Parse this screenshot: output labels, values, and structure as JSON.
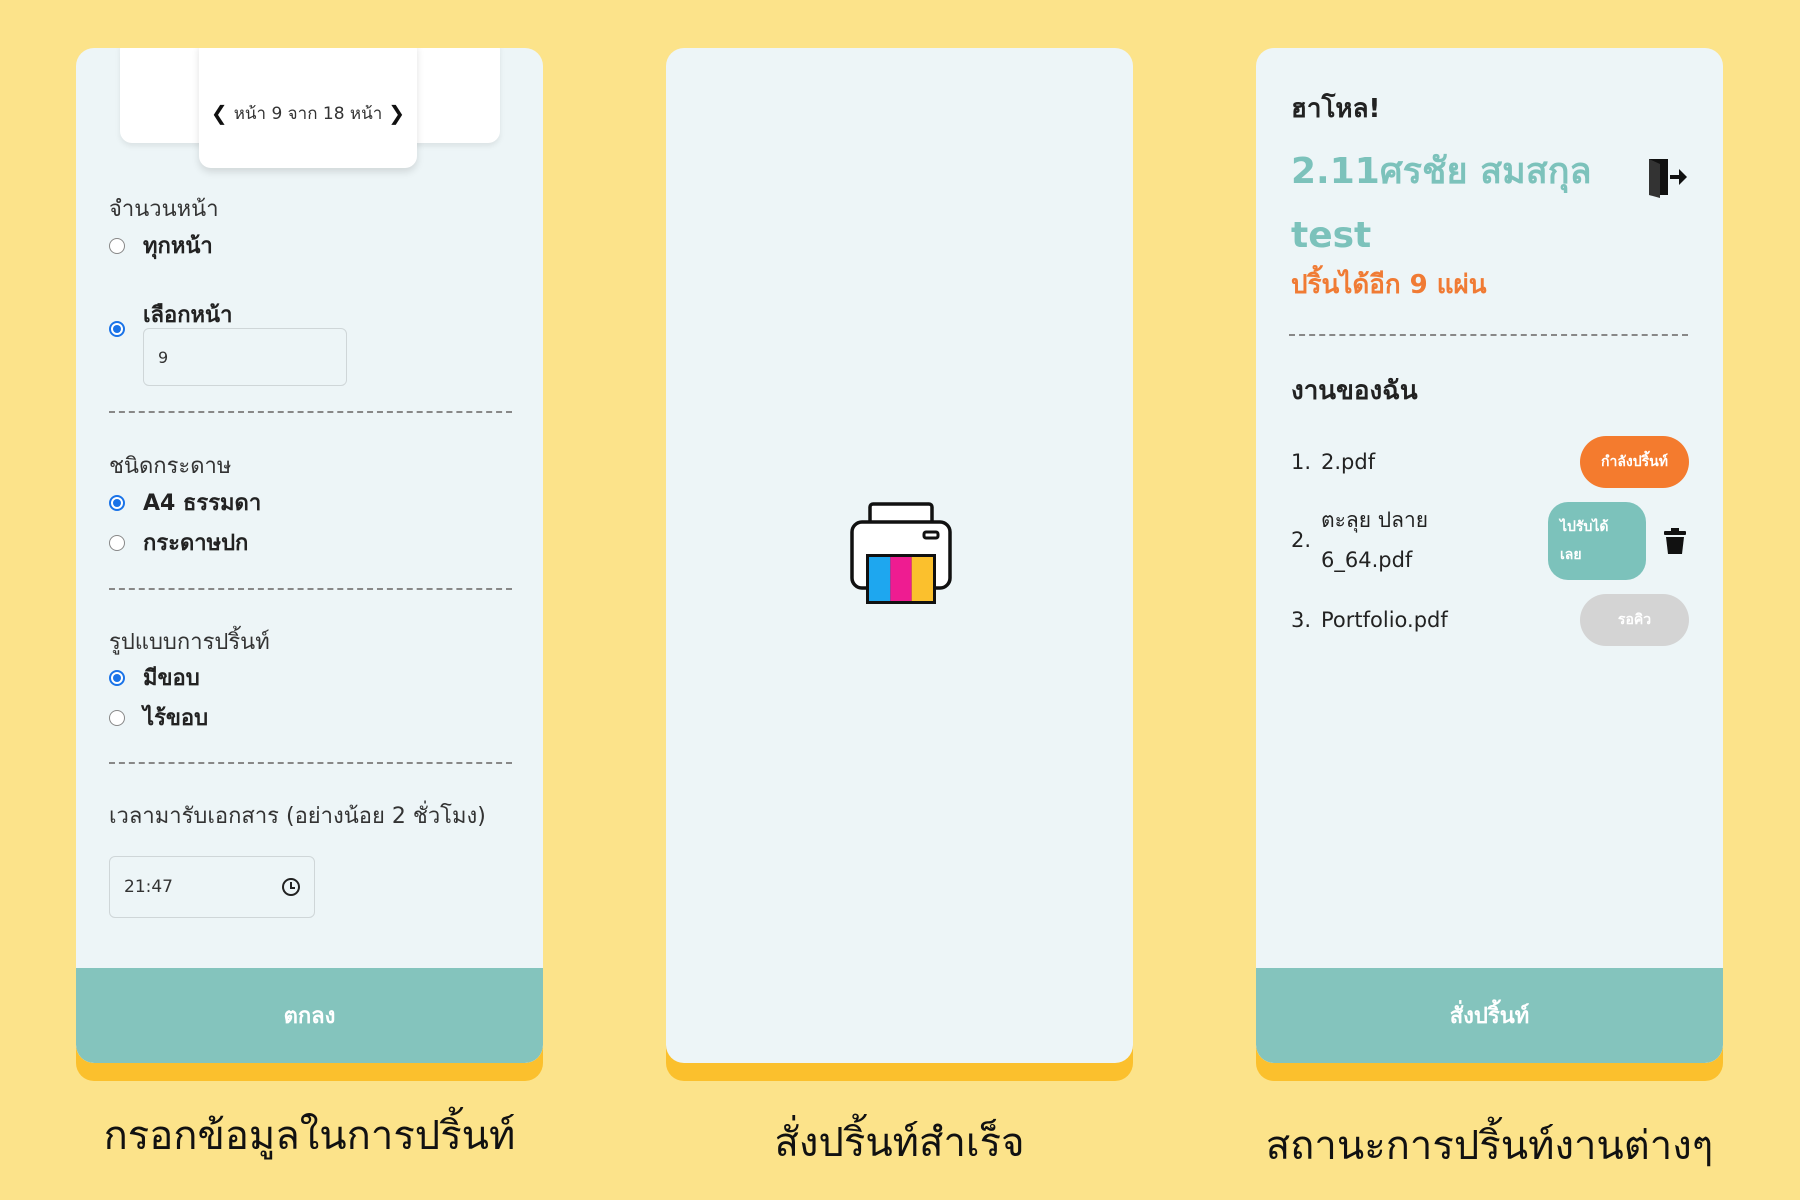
{
  "panel1": {
    "pager": {
      "text": "หน้า 9 จาก 18 หน้า",
      "prev_icon": "chevron-left-icon",
      "next_icon": "chevron-right-icon"
    },
    "pages_section": {
      "title": "จำนวนหน้า",
      "options": [
        "ทุกหน้า",
        "เลือกหน้า"
      ],
      "selected": "เลือกหน้า",
      "page_value": "9"
    },
    "paper_section": {
      "title": "ชนิดกระดาษ",
      "options": [
        "A4 ธรรมดา",
        "กระดาษปก"
      ],
      "selected": "A4 ธรรมดา"
    },
    "format_section": {
      "title": "รูปแบบการปริ้นท์",
      "options": [
        "มีขอบ",
        "ไร้ขอบ"
      ],
      "selected": "มีขอบ"
    },
    "time_section": {
      "title": "เวลามารับเอกสาร (อย่างน้อย 2 ชั่วโมง)",
      "time_value": "21:47",
      "icon": "clock-icon"
    },
    "submit_label": "ตกลง"
  },
  "panel2": {
    "icon": "printer-icon",
    "colors": [
      "#1ea7ef",
      "#ee1c91",
      "#fbc02d"
    ]
  },
  "panel3": {
    "greeting": "ฮาโหล!",
    "username": "2.11ศรชัย สมสกุล test",
    "quota": "ปริ้นได้อีก 9 แผ่น",
    "logout_icon": "logout-icon",
    "my_work_title": "งานของฉัน",
    "jobs": [
      {
        "num": "1.",
        "name": "2.pdf",
        "status": "กำลังปริ้นท์",
        "status_color": "#f47b2e"
      },
      {
        "num": "2.",
        "name_line1": "ตะลุย ปลาย",
        "name_line2": "6_64.pdf",
        "status_line1": "ไปรับได้",
        "status_line2": "เลย",
        "status_color": "#7cc2bb",
        "delete_icon": "trash-icon"
      },
      {
        "num": "3.",
        "name": "Portfolio.pdf",
        "status": "รอคิว",
        "status_color": "#d4d4d4"
      }
    ],
    "order_label": "สั่งปริ้นท์"
  },
  "captions": [
    "กรอกข้อมูลในการปริ้นท์",
    "สั่งปริ้นท์สำเร็จ",
    "สถานะการปริ้นท์งานต่างๆ"
  ],
  "theme": {
    "background": "#fce38a",
    "panel": "#edf5f7",
    "accent_teal": "#84c4bd",
    "shadow_yellow": "#fbc02d",
    "orange": "#f07b34"
  }
}
